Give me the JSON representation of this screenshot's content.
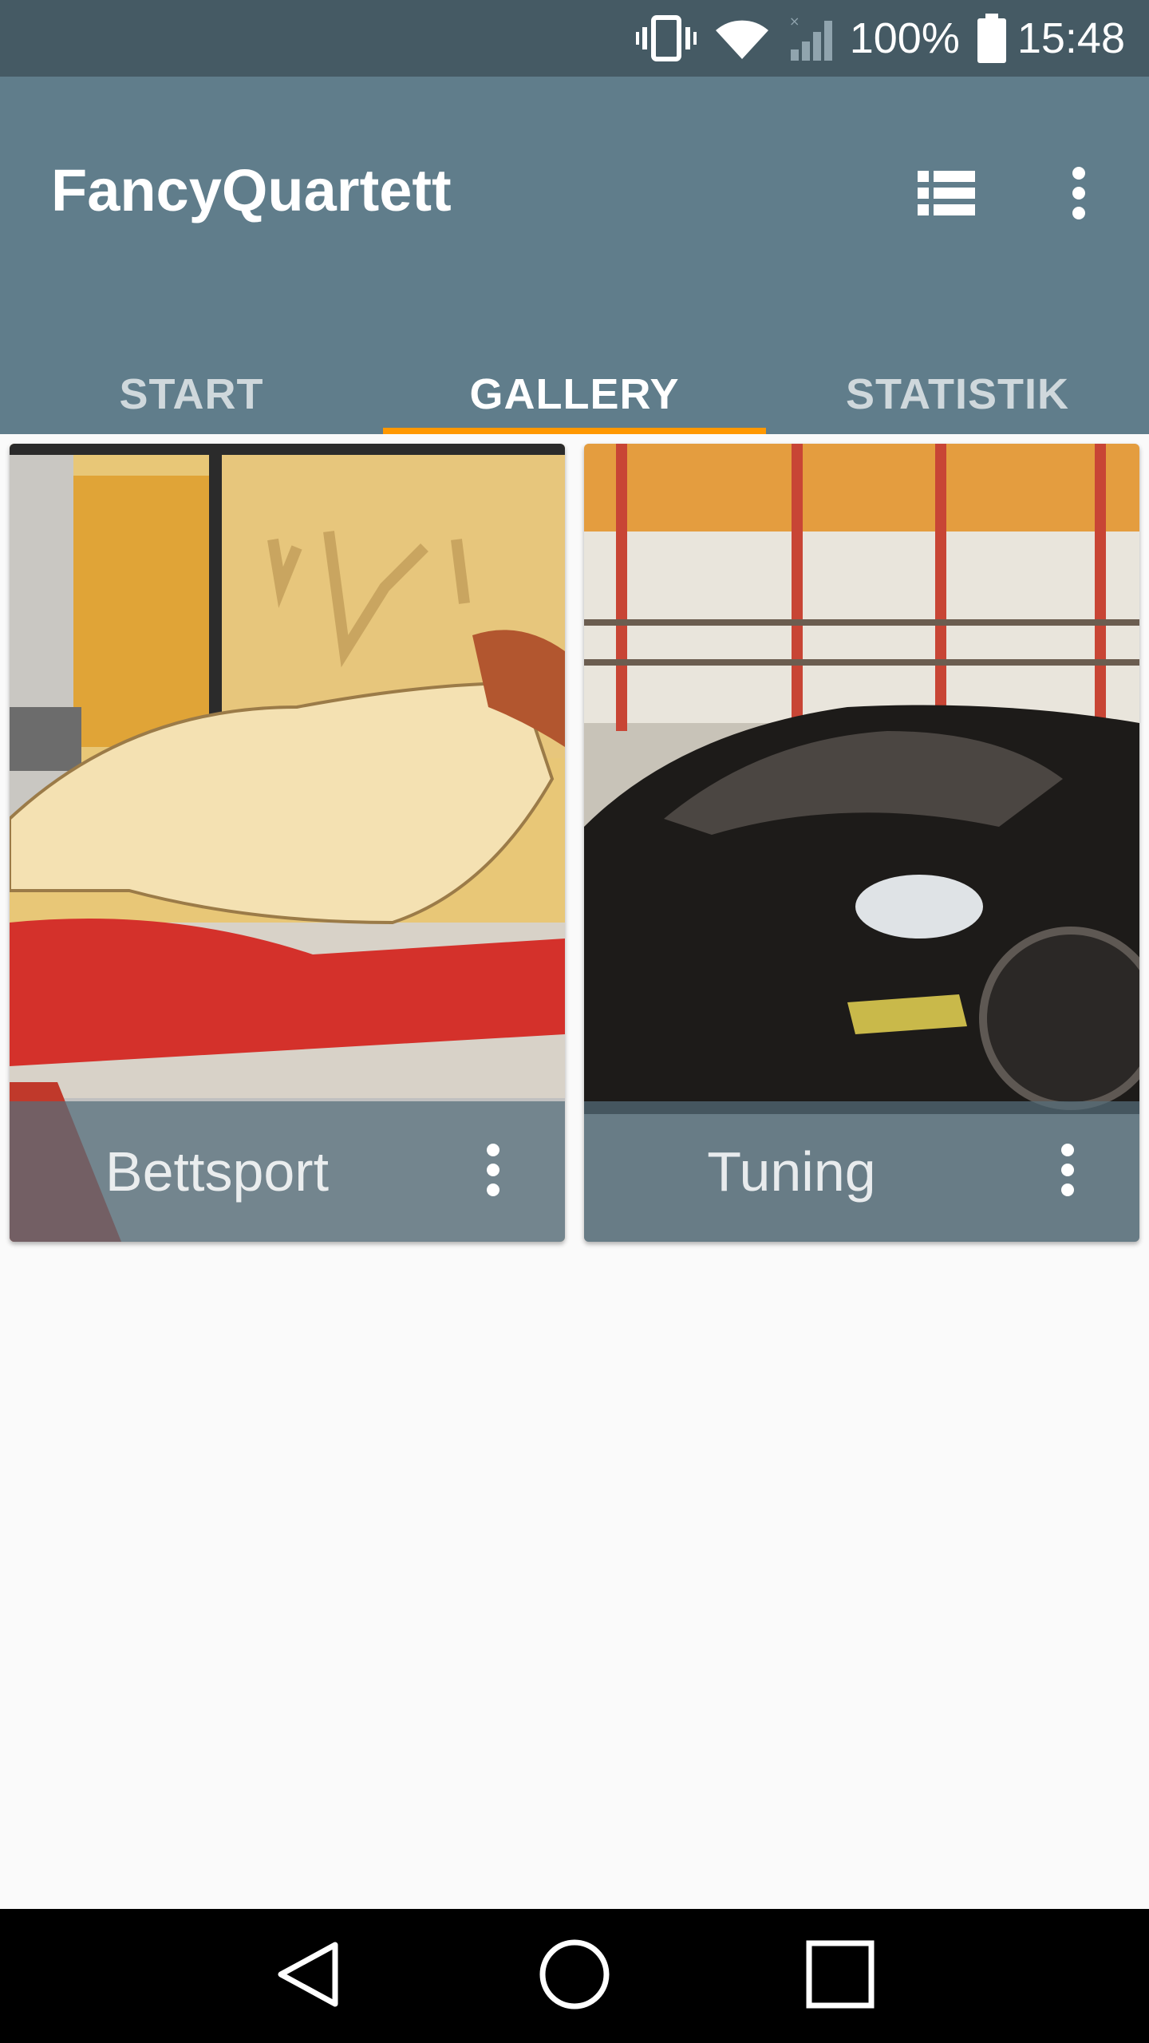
{
  "status_bar": {
    "battery": "100%",
    "time": "15:48",
    "icons": [
      "vibrate-icon",
      "wifi-icon",
      "signal-icon",
      "battery-icon"
    ]
  },
  "app_bar": {
    "title": "FancyQuartett",
    "actions": [
      "list-view-icon",
      "overflow-menu-icon"
    ]
  },
  "tabs": [
    {
      "label": "START",
      "active": false
    },
    {
      "label": "GALLERY",
      "active": true
    },
    {
      "label": "STATISTIK",
      "active": false
    }
  ],
  "gallery": {
    "cards": [
      {
        "title": "Bettsport",
        "image": "cartoon-illustration"
      },
      {
        "title": "Tuning",
        "image": "dark-sports-car-in-garage"
      }
    ]
  },
  "colors": {
    "status_bar": "#455a64",
    "primary": "#607d8b",
    "accent": "#ff9800",
    "background": "#fafafa"
  },
  "nav_bar": {
    "buttons": [
      "back-icon",
      "home-icon",
      "recents-icon"
    ]
  }
}
